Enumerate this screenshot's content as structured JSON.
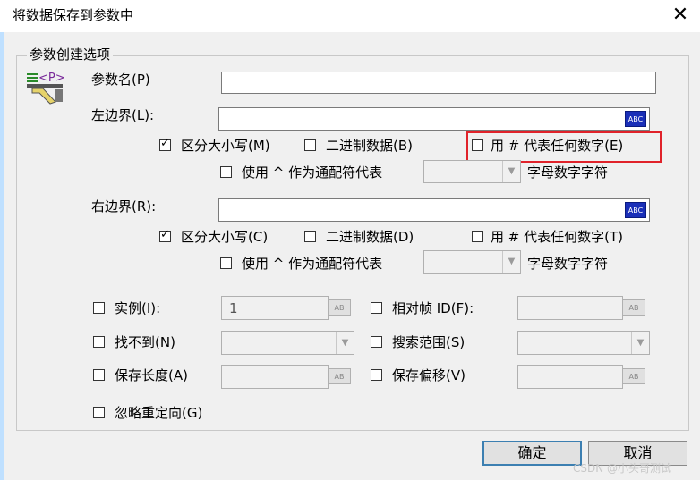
{
  "window": {
    "title": "将数据保存到参数中",
    "close_glyph": "✕"
  },
  "group": {
    "legend": "参数创建选项"
  },
  "param_name": {
    "label": "参数名(P)",
    "value": ""
  },
  "left_boundary": {
    "label": "左边界(L):",
    "value": "",
    "abc_label": "ABC",
    "case_sensitive": {
      "label": "区分大小写(M)",
      "checked": true
    },
    "binary_data": {
      "label": "二进制数据(B)",
      "checked": false
    },
    "hash_digit": {
      "label": "用 # 代表任何数字(E)",
      "checked": false
    },
    "caret_wildcard": {
      "label": "使用 ^ 作为通配符代表",
      "checked": false
    },
    "wildcard_select_value": "",
    "wildcard_suffix": "字母数字字符"
  },
  "right_boundary": {
    "label": "右边界(R):",
    "value": "",
    "abc_label": "ABC",
    "case_sensitive": {
      "label": "区分大小写(C)",
      "checked": true
    },
    "binary_data": {
      "label": "二进制数据(D)",
      "checked": false
    },
    "hash_digit": {
      "label": "用 # 代表任何数字(T)",
      "checked": false
    },
    "caret_wildcard": {
      "label": "使用 ^ 作为通配符代表",
      "checked": false
    },
    "wildcard_select_value": "",
    "wildcard_suffix": "字母数字字符"
  },
  "options": {
    "instance": {
      "label": "实例(I):",
      "value": "1",
      "checked": false
    },
    "relative_frame": {
      "label": "相对帧 ID(F):",
      "value": "",
      "checked": false
    },
    "not_found": {
      "label": "找不到(N)",
      "value": "",
      "checked": false
    },
    "search_scope": {
      "label": "搜索范围(S)",
      "value": "",
      "checked": false
    },
    "save_length": {
      "label": "保存长度(A)",
      "value": "",
      "checked": false
    },
    "save_offset": {
      "label": "保存偏移(V)",
      "value": "",
      "checked": false
    },
    "ignore_redirect": {
      "label": "忽略重定向(G)",
      "checked": false
    },
    "ab_label": "AB"
  },
  "buttons": {
    "ok": "确定",
    "cancel": "取消"
  },
  "watermark": "CSDN @小头哥测试",
  "colors": {
    "highlight": "#e0222a",
    "abc_button": "#1a2fb8",
    "default_button_border": "#3c7fb1"
  }
}
